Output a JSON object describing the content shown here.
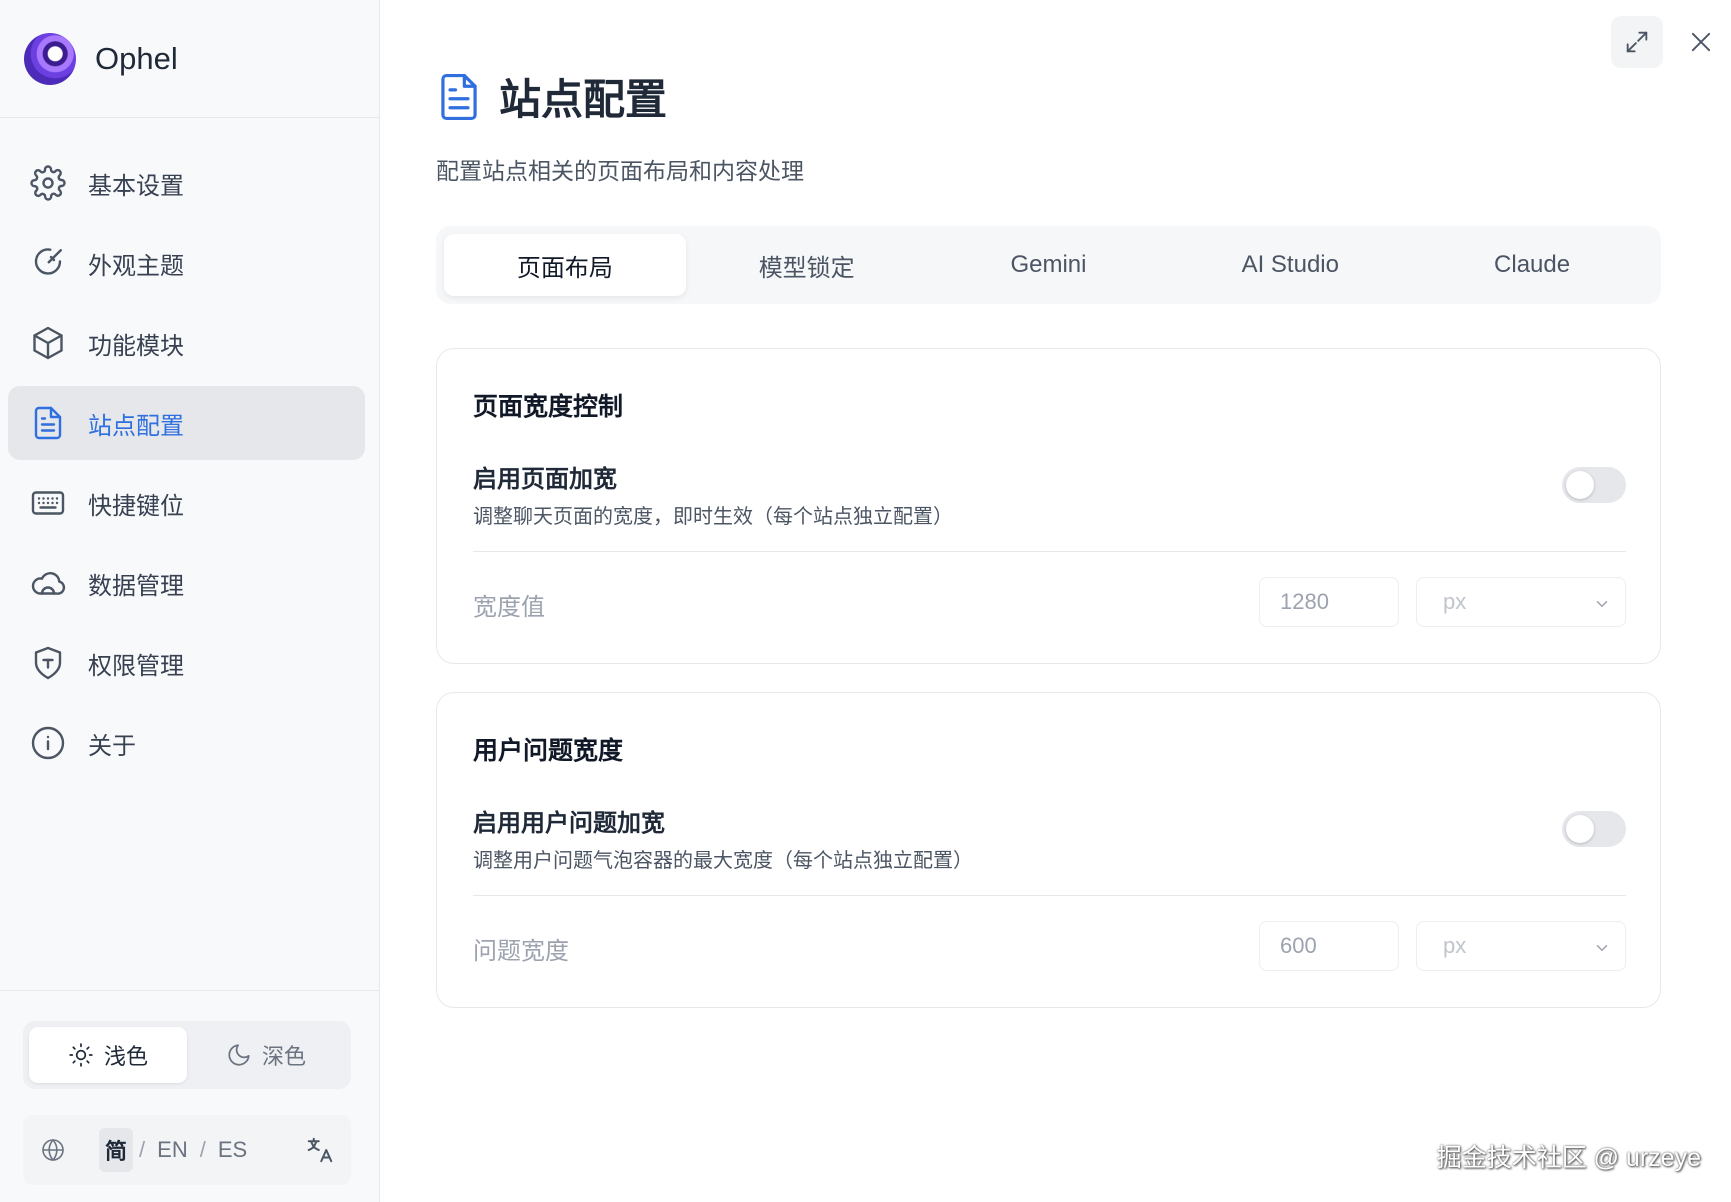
{
  "app": {
    "name": "Ophel"
  },
  "sidebar": {
    "items": [
      {
        "label": "基本设置",
        "icon": "gear-icon"
      },
      {
        "label": "外观主题",
        "icon": "palette-icon"
      },
      {
        "label": "功能模块",
        "icon": "cube-icon"
      },
      {
        "label": "站点配置",
        "icon": "document-icon",
        "active": true
      },
      {
        "label": "快捷键位",
        "icon": "keyboard-icon"
      },
      {
        "label": "数据管理",
        "icon": "cloud-icon"
      },
      {
        "label": "权限管理",
        "icon": "shield-icon"
      },
      {
        "label": "关于",
        "icon": "info-icon"
      }
    ],
    "theme": {
      "light": "浅色",
      "dark": "深色",
      "selected": "light"
    },
    "languages": {
      "options": [
        "简",
        "EN",
        "ES"
      ],
      "separator": "/",
      "selected": "简"
    }
  },
  "main": {
    "title": "站点配置",
    "description": "配置站点相关的页面布局和内容处理",
    "tabs": [
      "页面布局",
      "模型锁定",
      "Gemini",
      "AI Studio",
      "Claude"
    ],
    "active_tab": "页面布局",
    "cards": [
      {
        "title": "页面宽度控制",
        "setting_label": "启用页面加宽",
        "setting_desc": "调整聊天页面的宽度，即时生效（每个站点独立配置）",
        "enabled": false,
        "field_label": "宽度值",
        "value": "1280",
        "unit": "px"
      },
      {
        "title": "用户问题宽度",
        "setting_label": "启用用户问题加宽",
        "setting_desc": "调整用户问题气泡容器的最大宽度（每个站点独立配置）",
        "enabled": false,
        "field_label": "问题宽度",
        "value": "600",
        "unit": "px"
      }
    ]
  },
  "watermark": "掘金技术社区 @ urzeye",
  "colors": {
    "accent": "#2f6fe0",
    "active_bg": "#e5e7eb",
    "toggle_off": "#e5e7eb"
  }
}
